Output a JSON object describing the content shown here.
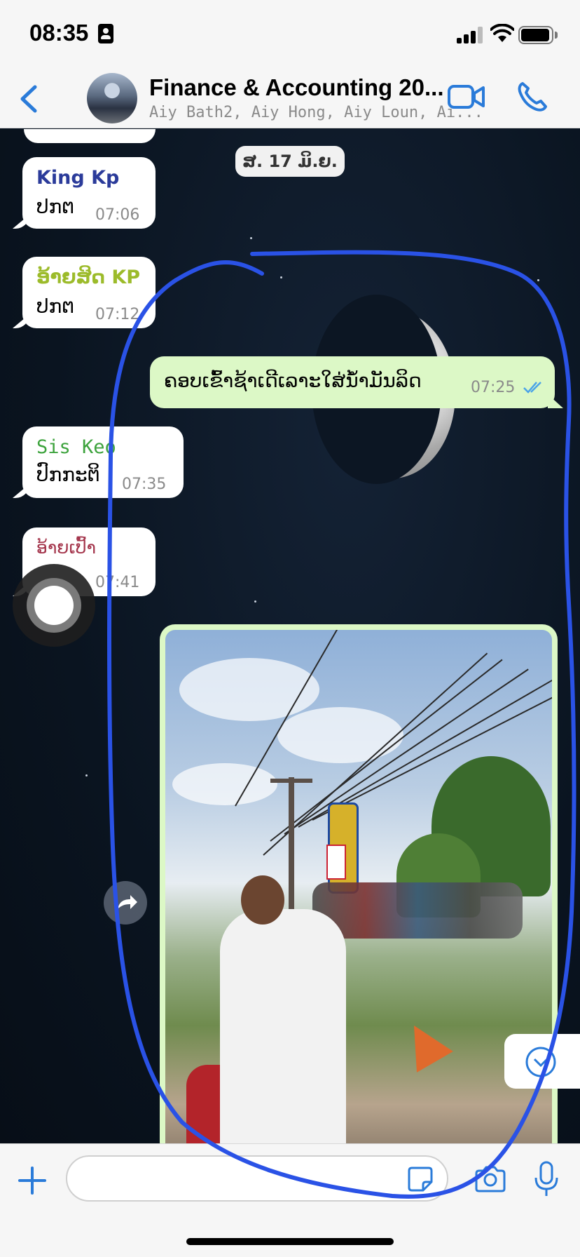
{
  "status_bar": {
    "time": "08:35"
  },
  "header": {
    "title": "Finance & Accounting 20...",
    "subtitle": "Aiy Bath2, Aiy Hong, Aiy Loun, Ai...",
    "icons": {
      "back": "chevron-left-icon",
      "video": "video-camera-icon",
      "call": "phone-icon"
    }
  },
  "date_separator": "ສ. 17 ມິ.ຍ.",
  "messages": [
    {
      "sender": "King Kp",
      "sender_color": "#2b3b9a",
      "text": "ປກຕ",
      "time": "07:06"
    },
    {
      "sender": "ອ້າຍສິດ KP",
      "sender_color": "#9cbb2a",
      "text": "ປກຕ",
      "time": "07:12"
    },
    {
      "text": "ຄອບເຂົ້າຊ້າເດີເລາະໃສ່ນ້ຳມັນລິດ",
      "time": "07:25",
      "outgoing": true,
      "status": "read-double-check-icon"
    },
    {
      "sender": "Sis Keo",
      "sender_color": "#3da33d",
      "text": "ປົກກະຕິ",
      "time": "07:35"
    },
    {
      "sender": "ອ້າຍເປົ້າ",
      "sender_color": "#a3334a",
      "text": "",
      "time": "07:41"
    }
  ],
  "composer": {
    "placeholder": "",
    "icons": {
      "attach": "plus-icon",
      "sticker": "sticker-icon",
      "camera": "camera-icon",
      "mic": "microphone-icon"
    }
  },
  "colors": {
    "accent": "#2a7bd9",
    "outgoing_bubble": "#dcf8c6",
    "annotation": "#2a52e6"
  }
}
